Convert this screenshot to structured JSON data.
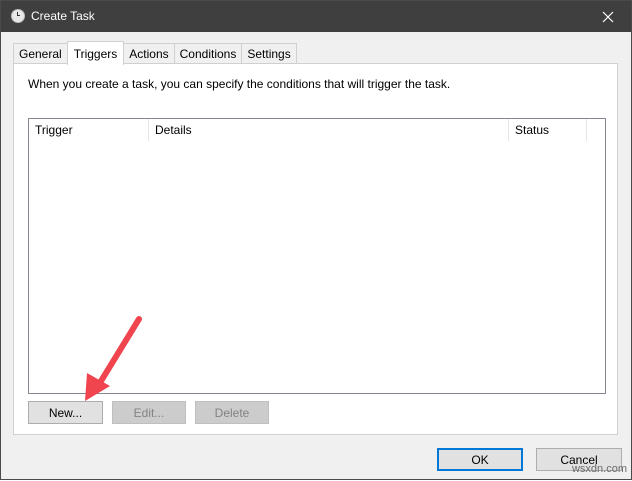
{
  "window": {
    "title": "Create Task"
  },
  "tabs": [
    {
      "label": "General"
    },
    {
      "label": "Triggers"
    },
    {
      "label": "Actions"
    },
    {
      "label": "Conditions"
    },
    {
      "label": "Settings"
    }
  ],
  "active_tab": "Triggers",
  "triggers_panel": {
    "description": "When you create a task, you can specify the conditions that will trigger the task.",
    "columns": [
      "Trigger",
      "Details",
      "Status"
    ],
    "rows": [],
    "buttons": {
      "new": "New...",
      "edit": "Edit...",
      "delete": "Delete"
    }
  },
  "footer": {
    "ok": "OK",
    "cancel": "Cancel"
  },
  "watermark": "wsxdn.com",
  "colors": {
    "titlebar": "#3f3f3f",
    "arrow": "#f0454f",
    "accent": "#0078d7"
  },
  "icons": {
    "window": "clock-icon",
    "close": "close-icon",
    "annotation": "red-arrow-icon"
  }
}
